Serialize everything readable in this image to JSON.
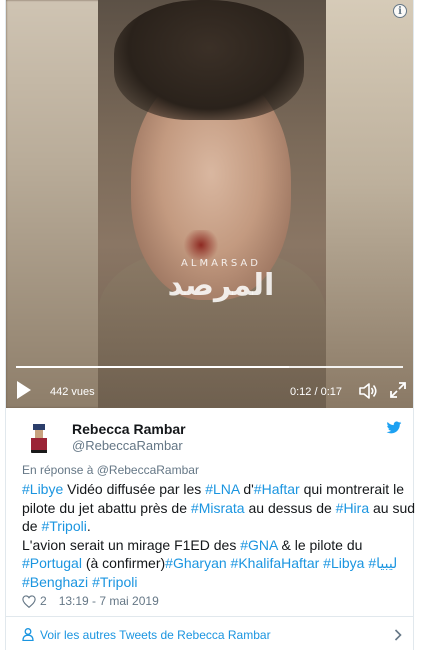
{
  "video": {
    "watermark_latin": "ALMARSAD",
    "watermark_arabic": "المرصد",
    "views": "442 vues",
    "time": "0:12 / 0:17",
    "progress_fraction": 0.706,
    "info_label": "i"
  },
  "author": {
    "name": "Rebecca Rambar",
    "handle": "@RebeccaRambar"
  },
  "tweet": {
    "reply_to": "En réponse à @RebeccaRambar",
    "line1": {
      "h1": "#Libye",
      "t1": " Vidéo diffusée par les ",
      "h2": "#LNA",
      "t2": " d'",
      "h3": "#Haftar",
      "t3": " qui montrerait le"
    },
    "line2": {
      "t1": "pilote du jet abattu près de ",
      "h1": "#Misrata",
      "t2": " au dessus de ",
      "h2": "#Hira",
      "t3": " au sud"
    },
    "line3": {
      "t1": "de ",
      "h1": "#Tripoli",
      "t2": "."
    },
    "line4": {
      "t1": "L'avion serait un mirage F1ED des ",
      "h1": "#GNA",
      "t2": " & le pilote du"
    },
    "line5": {
      "h1": "#Portugal",
      "t1": " (à confirmer)",
      "h2": "#Gharyan",
      "t2": " ",
      "h3": "#KhalifaHaftar",
      "t3": " ",
      "h4": "#Libya",
      "t4": " ",
      "h5": "#ليبيا"
    },
    "line6": {
      "h1": "#Benghazi",
      "t1": " ",
      "h2": "#Tripoli"
    }
  },
  "meta": {
    "likes": "2",
    "timestamp": "13:19 - 7 mai 2019"
  },
  "footer": {
    "more_tweets": "Voir les autres Tweets de Rebecca Rambar"
  },
  "colors": {
    "link": "#1b95e0",
    "muted": "#657786",
    "text": "#14171a",
    "border": "#e1e8ed"
  },
  "icons": [
    "info-icon",
    "play-icon",
    "volume-icon",
    "fullscreen-icon",
    "twitter-bird-icon",
    "heart-icon",
    "person-icon",
    "chevron-right-icon"
  ]
}
